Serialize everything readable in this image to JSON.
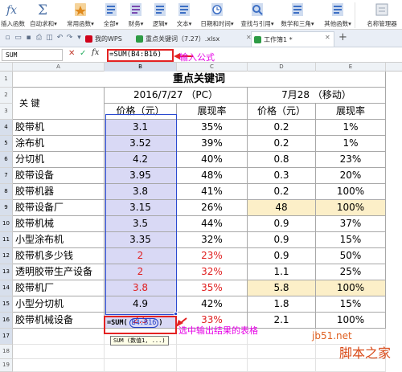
{
  "ribbon": {
    "buttons": [
      {
        "label": "插入函数",
        "icon": "fx-icon",
        "color": "#4a6fa5"
      },
      {
        "label": "自动求和▾",
        "icon": "sigma-icon",
        "color": "#4a6fa5"
      },
      {
        "label": "常用函数▾",
        "icon": "star-icon",
        "color": "#e08a1e"
      },
      {
        "label": "全部▾",
        "icon": "book-icon",
        "color": "#3d6fc4"
      },
      {
        "label": "财务▾",
        "icon": "finance-icon",
        "color": "#7a4ab0"
      },
      {
        "label": "逻辑▾",
        "icon": "logic-icon",
        "color": "#3d6fc4"
      },
      {
        "label": "文本▾",
        "icon": "text-icon",
        "color": "#3d6fc4"
      },
      {
        "label": "日期和时间▾",
        "icon": "clock-icon",
        "color": "#3d6fc4"
      },
      {
        "label": "查找与引用▾",
        "icon": "search-icon",
        "color": "#3d6fc4"
      },
      {
        "label": "数学和三角▾",
        "icon": "math-icon",
        "color": "#3d6fc4"
      },
      {
        "label": "其他函数▾",
        "icon": "more-icon",
        "color": "#3d6fc4"
      },
      {
        "label": "名称管理器",
        "icon": "name-manager-icon",
        "color": "#9aa5b5"
      }
    ]
  },
  "tabs": [
    {
      "label": "我的WPS",
      "icon": "wps-icon",
      "color": "#d0021b"
    },
    {
      "label": "重点关键词（7.27）.xlsx",
      "icon": "sheet-icon",
      "color": "#2e9b45"
    },
    {
      "label": "工作簿1 *",
      "icon": "sheet-icon",
      "color": "#2e9b45"
    }
  ],
  "formula_bar": {
    "name_box": "SUM",
    "cancel_glyph": "✕",
    "confirm_glyph": "✓",
    "fx_label": "fx",
    "formula": "=SUM(B4:B16)"
  },
  "annotations": {
    "input_formula": "输入公式",
    "select_output": "选中输出结果的表格"
  },
  "columns": [
    "A",
    "B",
    "C",
    "D",
    "E"
  ],
  "rows": [
    "1",
    "2",
    "3",
    "4",
    "5",
    "6",
    "7",
    "8",
    "9",
    "10",
    "11",
    "12",
    "13",
    "14",
    "15",
    "16",
    "17",
    "18",
    "19"
  ],
  "table": {
    "title": "重点关键词",
    "keyword_header": "关 键",
    "date1": "2016/7/27 （PC）",
    "date2": "7月28 （移动）",
    "price_header": "价格（元）",
    "rate_header": "展现率",
    "data": [
      {
        "kw": "胶带机",
        "p1": "3.1",
        "r1": "35%",
        "p2": "0.2",
        "r2": "1%"
      },
      {
        "kw": "涂布机",
        "p1": "3.52",
        "r1": "39%",
        "p2": "0.2",
        "r2": "1%"
      },
      {
        "kw": "分切机",
        "p1": "4.2",
        "r1": "40%",
        "p2": "0.8",
        "r2": "23%"
      },
      {
        "kw": "胶带设备",
        "p1": "3.95",
        "r1": "48%",
        "p2": "0.3",
        "r2": "20%"
      },
      {
        "kw": "胶带机器",
        "p1": "3.8",
        "r1": "41%",
        "p2": "0.2",
        "r2": "100%"
      },
      {
        "kw": "胶带设备厂",
        "p1": "3.15",
        "r1": "26%",
        "p2": "48",
        "r2": "100%"
      },
      {
        "kw": "胶带机械",
        "p1": "3.5",
        "r1": "44%",
        "p2": "0.9",
        "r2": "37%"
      },
      {
        "kw": "小型涂布机",
        "p1": "3.35",
        "r1": "32%",
        "p2": "0.9",
        "r2": "15%"
      },
      {
        "kw": "胶带机多少钱",
        "p1": "2",
        "r1": "23%",
        "p2": "0.9",
        "r2": "50%"
      },
      {
        "kw": "透明胶带生产设备",
        "p1": "2",
        "r1": "32%",
        "p2": "1.1",
        "r2": "25%"
      },
      {
        "kw": "胶带机厂",
        "p1": "3.8",
        "r1": "35%",
        "p2": "5.8",
        "r2": "100%"
      },
      {
        "kw": "小型分切机",
        "p1": "4.9",
        "r1": "42%",
        "p2": "1.8",
        "r2": "15%"
      },
      {
        "kw": "胶带机械设备",
        "p1": "2.5",
        "r1": "33%",
        "p2": "2.1",
        "r2": "100%"
      }
    ]
  },
  "active_cell": {
    "prefix": "=SUM",
    "open": "(",
    "range": "B4:B16",
    "close": ")"
  },
  "tooltip": "SUM (数值1, ...)",
  "watermark": {
    "site": "jb51.net",
    "brand": "脚本之家"
  },
  "colors": {
    "selection": "#d9d9f5",
    "highlight": "#fcefc8",
    "red": "#e02020",
    "annotation": "#e600e6",
    "box": "#e32222"
  }
}
